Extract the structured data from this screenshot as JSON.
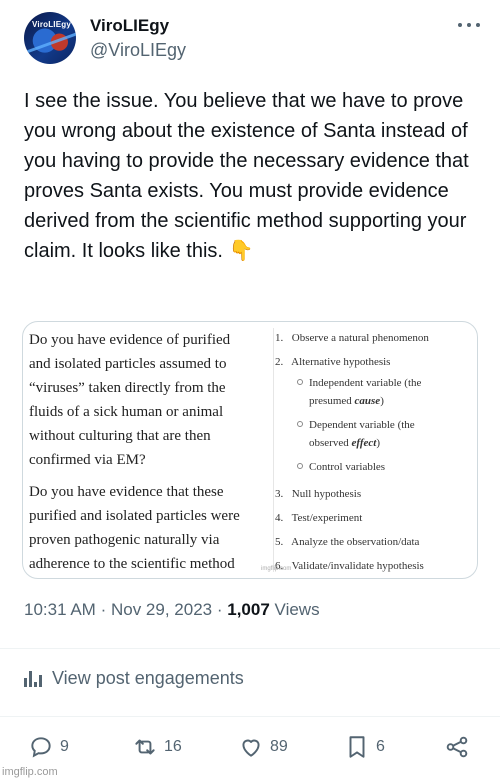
{
  "author": {
    "display_name": "ViroLIEgy",
    "handle": "@ViroLIEgy",
    "avatar_text": "ViroLIEgy"
  },
  "tweet": {
    "text": "I see the issue. You believe that we have to prove you wrong about the existence of Santa instead of you having to provide the necessary evidence that proves Santa exists. You must provide evidence derived from the scientific method supporting your claim. It looks like this. 👇"
  },
  "media": {
    "left_paragraph_1": [
      "Do you have evidence of purified",
      "and isolated particles assumed to",
      "“viruses” taken directly from the",
      "fluids of a sick human or animal",
      "without culturing that are then",
      "confirmed via EM?"
    ],
    "left_paragraph_2": [
      "Do you have evidence that these",
      "purified and isolated particles were",
      "proven pathogenic naturally via",
      "adherence to the scientific method"
    ],
    "steps": {
      "s1_num": "1.",
      "s1": "Observe a natural phenomenon",
      "s2_num": "2.",
      "s2": "Alternative hypothesis",
      "sub1_a": "Independent variable (the",
      "sub1_b": "presumed ",
      "sub1_c": "cause",
      "sub1_d": ")",
      "sub2_a": "Dependent variable (the",
      "sub2_b": "observed ",
      "sub2_c": "effect",
      "sub2_d": ")",
      "sub3": "Control variables",
      "s3_num": "3.",
      "s3": "Null hypothesis",
      "s4_num": "4.",
      "s4": "Test/experiment",
      "s5_num": "5.",
      "s5": "Analyze the observation/data",
      "s6_num": "6.",
      "s6": "Validate/invalidate hypothesis"
    },
    "watermark": "imgflip.com"
  },
  "meta": {
    "time": "10:31 AM",
    "separator": "·",
    "date": "Nov 29, 2023",
    "views_count": "1,007",
    "views_label": "Views"
  },
  "engagements_label": "View post engagements",
  "actions": {
    "replies": "9",
    "reposts": "16",
    "likes": "89",
    "bookmarks": "6"
  },
  "footer_watermark": "imgflip.com",
  "colors": {
    "text": "#0f1419",
    "secondary": "#536471",
    "border": "#cfd9de"
  },
  "icons": [
    "more-icon",
    "chart-icon",
    "reply-icon",
    "repost-icon",
    "like-icon",
    "bookmark-icon",
    "share-icon"
  ]
}
